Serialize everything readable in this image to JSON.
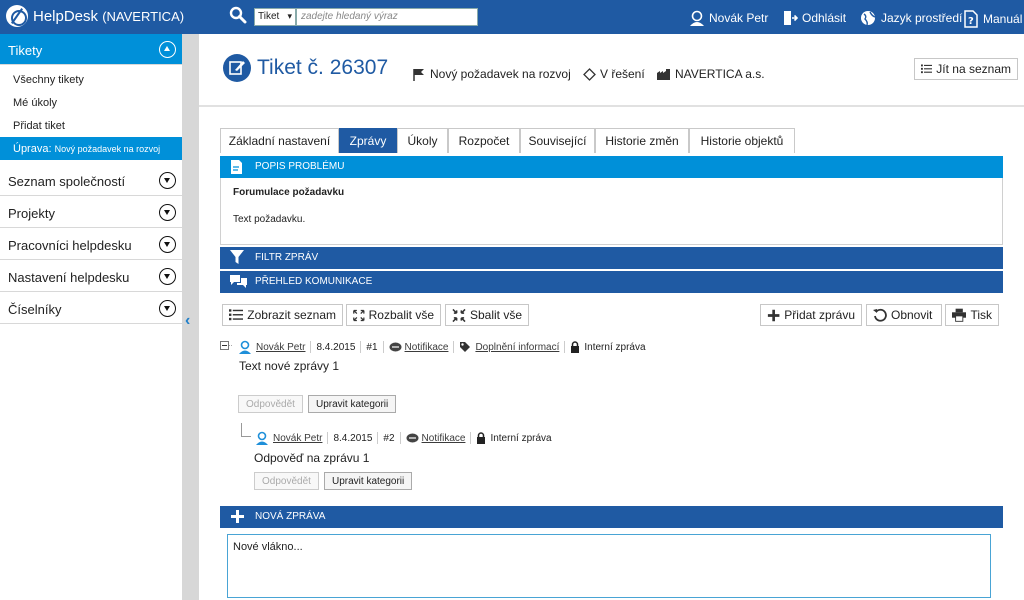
{
  "topbar": {
    "brand": "HelpDesk",
    "brand_sub": "(NAVERTICA)",
    "search_select": "Tiket",
    "search_placeholder": "zadejte hledaný výraz",
    "user": "Novák Petr",
    "logout": "Odhlásit",
    "language": "Jazyk prostředí",
    "manual": "Manuál"
  },
  "sidebar": {
    "sections": [
      {
        "label": "Tikety"
      },
      {
        "label": "Seznam společností"
      },
      {
        "label": "Projekty"
      },
      {
        "label": "Pracovníci helpdesku"
      },
      {
        "label": "Nastavení helpdesku"
      },
      {
        "label": "Číselníky"
      }
    ],
    "sub_items": [
      {
        "label": "Všechny tikety"
      },
      {
        "label": "Mé úkoly"
      },
      {
        "label": "Přidat tiket"
      }
    ],
    "active_item": {
      "label": "Úprava:",
      "detail": "Nový požadavek na rozvoj"
    }
  },
  "header": {
    "title": "Tiket č. 26307",
    "type": "Nový požadavek na rozvoj",
    "status": "V řešení",
    "company": "NAVERTICA a.s.",
    "list_button": "Jít na seznam"
  },
  "tabs": [
    {
      "label": "Základní nastavení"
    },
    {
      "label": "Zprávy"
    },
    {
      "label": "Úkoly"
    },
    {
      "label": "Rozpočet"
    },
    {
      "label": "Související"
    },
    {
      "label": "Historie změn"
    },
    {
      "label": "Historie objektů"
    }
  ],
  "problem": {
    "header": "POPIS PROBLÉMU",
    "title": "Forumulace požadavku",
    "text": "Text požadavku."
  },
  "filter_header": "FILTR ZPRÁV",
  "overview_header": "PŘEHLED KOMUNIKACE",
  "toolbar": {
    "show_list": "Zobrazit seznam",
    "expand_all": "Rozbalit vše",
    "collapse_all": "Sbalit vše",
    "add_message": "Přidat zprávu",
    "refresh": "Obnovit",
    "print": "Tisk"
  },
  "messages": [
    {
      "author": "Novák Petr",
      "date": "8.4.2015",
      "number": "#1",
      "notification": "Notifikace",
      "category": "Doplnění informací",
      "visibility": "Interní zpráva",
      "text": "Text nové zprávy 1",
      "reply_label": "Odpovědět",
      "edit_label": "Upravit kategorii"
    },
    {
      "author": "Novák Petr",
      "date": "8.4.2015",
      "number": "#2",
      "notification": "Notifikace",
      "visibility": "Interní zpráva",
      "text": "Odpověď na zprávu 1",
      "reply_label": "Odpovědět",
      "edit_label": "Upravit kategorii"
    }
  ],
  "new_message": {
    "header": "NOVÁ ZPRÁVA",
    "value": "Nové vlákno..."
  },
  "colors": {
    "primary": "#1f5aa3",
    "accent": "#0090d9"
  }
}
